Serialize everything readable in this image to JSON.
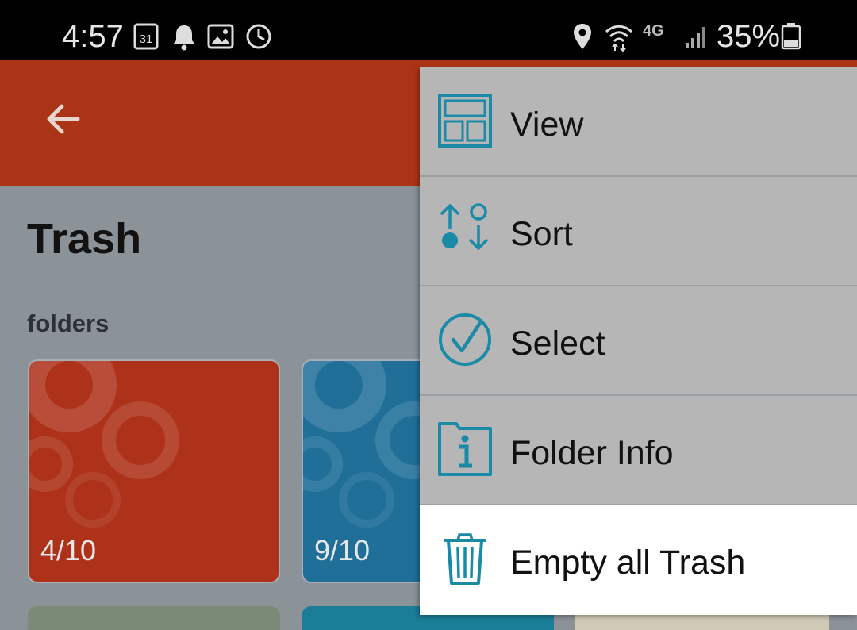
{
  "status_bar": {
    "time": "4:57",
    "calendar_day": "31",
    "network": "4G",
    "battery": "35%",
    "icons": [
      "calendar-icon",
      "bell-icon",
      "image-icon",
      "clock-icon",
      "location-icon",
      "wifi-icon",
      "signal-icon",
      "battery-icon"
    ]
  },
  "app_bar": {
    "back_icon": "arrow-left-icon"
  },
  "page": {
    "title": "Trash",
    "section_label": "folders",
    "folders": [
      {
        "count": "4/10",
        "color": "#ad3219"
      },
      {
        "count": "9/10",
        "color": "#1f6f99"
      }
    ]
  },
  "menu": {
    "items": [
      {
        "label": "View",
        "icon": "layout-icon"
      },
      {
        "label": "Sort",
        "icon": "sort-icon"
      },
      {
        "label": "Select",
        "icon": "check-circle-icon"
      },
      {
        "label": "Folder Info",
        "icon": "info-icon"
      },
      {
        "label": "Empty all Trash",
        "icon": "trash-icon"
      }
    ],
    "accent_color": "#1a8aa6"
  }
}
